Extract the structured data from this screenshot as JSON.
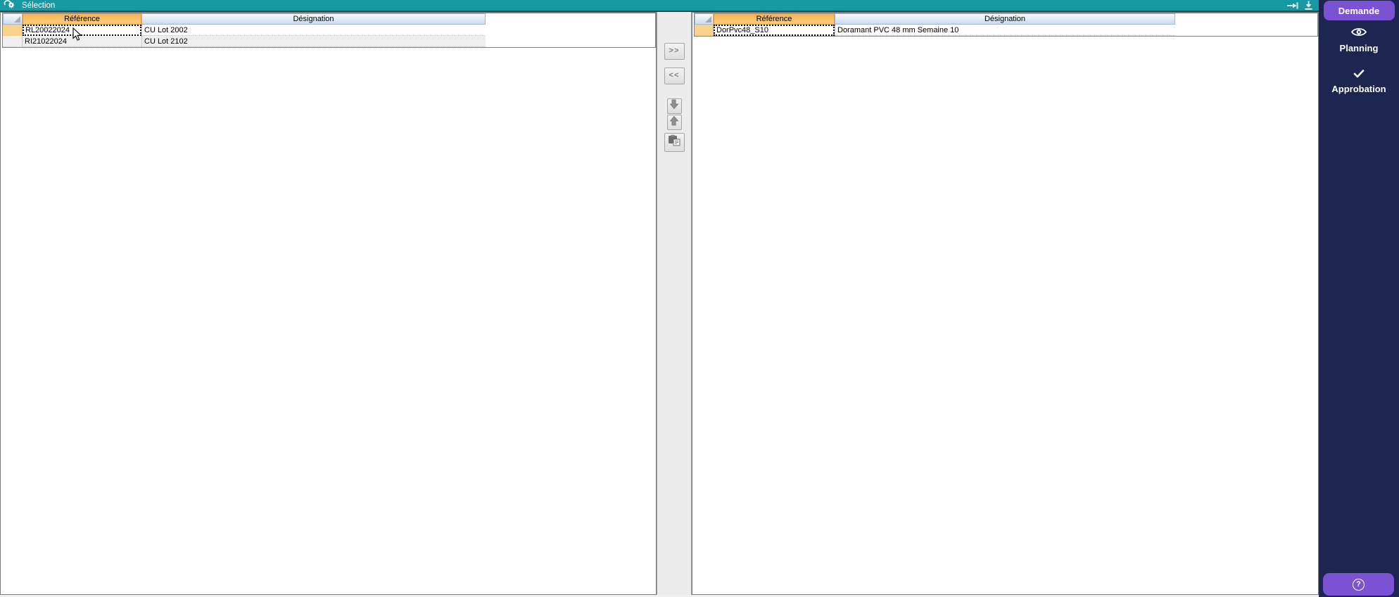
{
  "topbar": {
    "title": "Sélection",
    "icons": {
      "left": "selection-gear-icon",
      "right1": "arrow-to-bar-icon",
      "right2": "download-icon"
    }
  },
  "left_table": {
    "headers": {
      "reference": "Référence",
      "designation": "Désignation"
    },
    "rows": [
      {
        "reference": "RL20022024",
        "designation": "CU Lot 2002",
        "selected": true
      },
      {
        "reference": "RI21022024",
        "designation": "CU Lot 2102",
        "selected": false
      }
    ]
  },
  "right_table": {
    "headers": {
      "reference": "Référence",
      "designation": "Désignation"
    },
    "rows": [
      {
        "reference": "DorPvc48_S10",
        "designation": "Doramant PVC 48 mm Semaine 10",
        "selected": true
      }
    ]
  },
  "transfer_buttons": {
    "move_right": ">>",
    "move_left": "<<",
    "icons": {
      "down": "arrow-down-icon",
      "up": "arrow-up-icon",
      "copy": "paste-icon"
    }
  },
  "sidebar": {
    "demande_label": "Demande",
    "planning_label": "Planning",
    "approbation_label": "Approbation",
    "help_label": "?",
    "icons": {
      "planning": "eye-icon",
      "approbation": "check-icon",
      "help": "help-circle-icon"
    }
  },
  "colors": {
    "topbar_teal": "#1798a2",
    "sidebar_navy": "#1d2550",
    "accent_purple": "#7b52d4",
    "header_orange": "#f6c16a",
    "header_blue": "#dce6f3",
    "indicator_orange": "#fbd28d",
    "indicator_blue": "#dbe6f5",
    "row_alt_gray": "#efefef"
  }
}
